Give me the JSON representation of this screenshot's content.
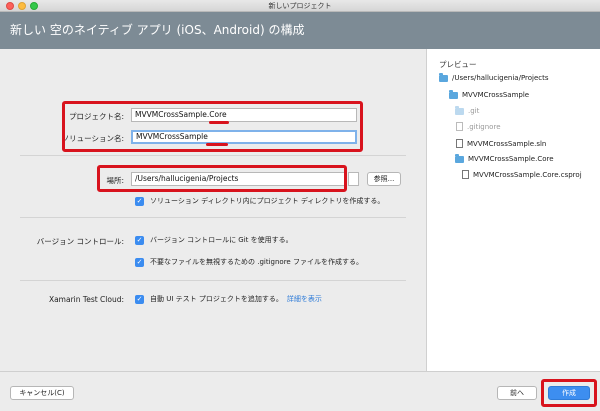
{
  "window": {
    "title": "新しいプロジェクト"
  },
  "header": {
    "title": "新しい 空のネイティブ アプリ (iOS、Android) の構成"
  },
  "form": {
    "project_name_label": "プロジェクト名:",
    "project_name_value": "MVVMCrossSample.Core",
    "solution_name_label": "ソリューション名:",
    "solution_name_value": "MVVMCrossSample",
    "location_label": "場所:",
    "location_value": "/Users/hallucigenia/Projects",
    "browse_label": "参照...",
    "create_solution_dir_label": "ソリューション ディレクトリ内にプロジェクト ディレクトリを作成する。",
    "version_control_label": "バージョン コントロール:",
    "use_git_label": "バージョン コントロールに Git を使用する。",
    "gitignore_label": "不要なファイルを無視するための .gitignore ファイルを作成する。",
    "test_cloud_label": "Xamarin Test Cloud:",
    "ui_test_label": "自動 UI テスト プロジェクトを追加する。",
    "details_link": "詳細を表示"
  },
  "preview": {
    "title": "プレビュー",
    "items": [
      {
        "label": "/Users/hallucigenia/Projects",
        "type": "folder"
      },
      {
        "label": "MVVMCrossSample",
        "type": "folder"
      },
      {
        "label": ".git",
        "type": "folder-dim"
      },
      {
        "label": ".gitignore",
        "type": "file-dim"
      },
      {
        "label": "MVVMCrossSample.sln",
        "type": "file"
      },
      {
        "label": "MVVMCrossSample.Core",
        "type": "folder"
      },
      {
        "label": "MVVMCrossSample.Core.csproj",
        "type": "file"
      }
    ]
  },
  "footer": {
    "cancel_label": "キャンセル(C)",
    "back_label": "前へ",
    "create_label": "作成"
  },
  "colors": {
    "header_bg": "#7d8b95",
    "annotation_red": "#d8131d",
    "accent_blue": "#3d8ef0"
  }
}
